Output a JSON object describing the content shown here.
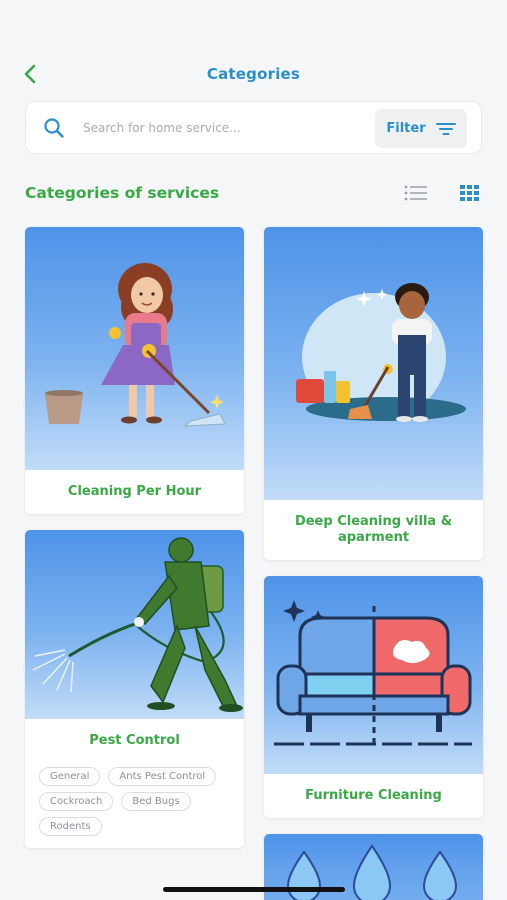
{
  "header": {
    "title": "Categories"
  },
  "search": {
    "placeholder": "Search for home service...",
    "filter_label": "Filter"
  },
  "section": {
    "title": "Categories of services"
  },
  "categories": {
    "cleaning_per_hour": {
      "title": "Cleaning Per Hour"
    },
    "deep_cleaning": {
      "title": "Deep Cleaning villa & aparment"
    },
    "pest_control": {
      "title": "Pest Control",
      "tags": [
        "General",
        "Ants Pest Control",
        "Cockroach",
        "Bed Bugs",
        "Rodents"
      ]
    },
    "furniture_cleaning": {
      "title": "Furniture Cleaning"
    }
  },
  "colors": {
    "accent_blue": "#2a8fc8",
    "accent_green": "#3aa845"
  },
  "icons": [
    "back-arrow-icon",
    "search-icon",
    "filter-icon",
    "list-view-icon",
    "grid-view-icon"
  ]
}
